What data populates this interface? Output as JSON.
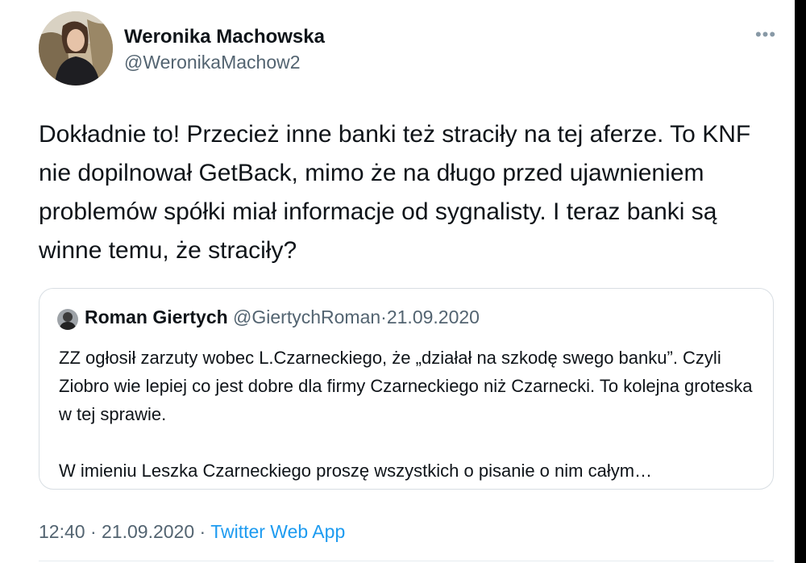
{
  "author": {
    "name": "Weronika Machowska",
    "handle": "@WeronikaMachow2"
  },
  "menu_icon": "more-dots-icon",
  "tweet_text": "Dokładnie to! Przecież inne banki też straciły na tej aferze. To KNF nie dopilnował GetBack, mimo że na długo przed ujawnieniem problemów spółki miał informacje od sygnalisty. I teraz banki są winne temu, że straciły?",
  "quoted": {
    "name": "Roman Giertych",
    "handle": "@GiertychRoman",
    "separator": "·",
    "date": "21.09.2020",
    "paragraph1": "ZZ ogłosił zarzuty wobec L.Czarneckiego, że „działał na szkodę swego banku”. Czyli Ziobro wie lepiej co jest dobre dla firmy Czarneckiego niż Czarnecki. To kolejna groteska w tej sprawie.",
    "paragraph2": "W imieniu Leszka Czarneckiego proszę wszystkich o pisanie o nim całym…"
  },
  "footer": {
    "time": "12:40",
    "separator": "·",
    "date": "21.09.2020",
    "source": "Twitter Web App"
  },
  "colors": {
    "link": "#1d9bf0",
    "secondary_text": "#536471",
    "border": "#d8dee3"
  }
}
